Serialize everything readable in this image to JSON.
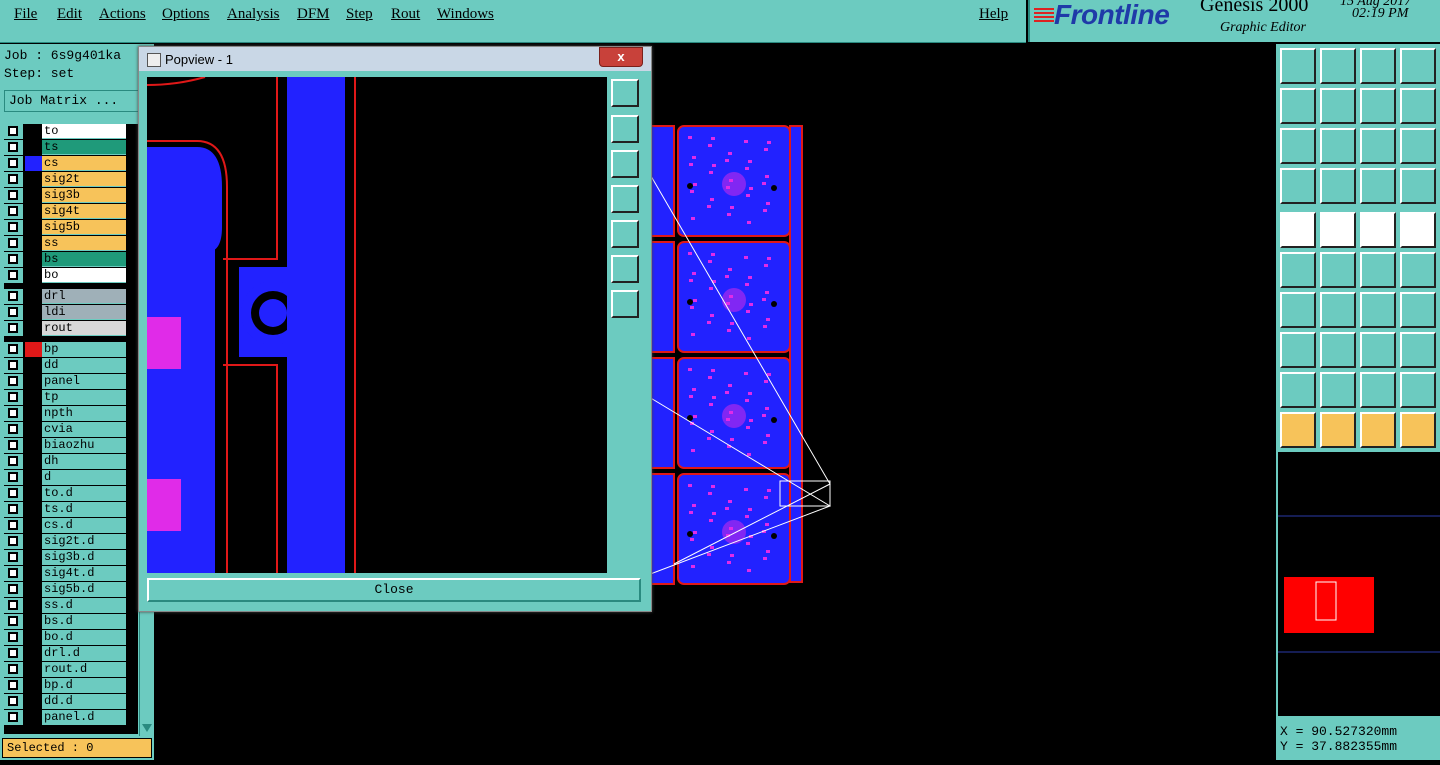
{
  "menu": {
    "items": [
      "File",
      "Edit",
      "Actions",
      "Options",
      "Analysis",
      "DFM",
      "Step",
      "Rout",
      "Windows"
    ],
    "help": "Help"
  },
  "brand": {
    "logo": "Frontline",
    "product": "Genesis 2000",
    "subtitle": "Graphic Editor",
    "date": "15 Aug 2017",
    "time": "02:19 PM"
  },
  "job": {
    "job_line": "Job : 6s9g401ka",
    "step_line": "Step: set",
    "matrix_button": "Job Matrix ..."
  },
  "layers": [
    {
      "name": "to",
      "bg": "#ffffff",
      "swatch": "#000000"
    },
    {
      "name": "ts",
      "bg": "#1f9a7a",
      "swatch": "#000000"
    },
    {
      "name": "cs",
      "bg": "#f7c35a",
      "swatch": "#2222ff"
    },
    {
      "name": "sig2t",
      "bg": "#f7c35a",
      "swatch": "#000000"
    },
    {
      "name": "sig3b",
      "bg": "#f7c35a",
      "swatch": "#000000"
    },
    {
      "name": "sig4t",
      "bg": "#f7c35a",
      "swatch": "#000000"
    },
    {
      "name": "sig5b",
      "bg": "#f7c35a",
      "swatch": "#000000"
    },
    {
      "name": "ss",
      "bg": "#f7c35a",
      "swatch": "#000000"
    },
    {
      "name": "bs",
      "bg": "#1f9a7a",
      "swatch": "#000000"
    },
    {
      "name": "bo",
      "bg": "#ffffff",
      "swatch": "#000000"
    },
    {
      "name": "drl",
      "bg": "#9fb0b8",
      "swatch": "#000000"
    },
    {
      "name": "ldi",
      "bg": "#9fb0b8",
      "swatch": "#000000"
    },
    {
      "name": "rout",
      "bg": "#d8d8d8",
      "swatch": "#000000"
    },
    {
      "name": "bp",
      "bg": "#6ccbc0",
      "swatch": "#e01818"
    },
    {
      "name": "dd",
      "bg": "#6ccbc0",
      "swatch": "#000000"
    },
    {
      "name": "panel",
      "bg": "#6ccbc0",
      "swatch": "#000000"
    },
    {
      "name": "tp",
      "bg": "#6ccbc0",
      "swatch": "#000000"
    },
    {
      "name": "npth",
      "bg": "#6ccbc0",
      "swatch": "#000000"
    },
    {
      "name": "cvia",
      "bg": "#6ccbc0",
      "swatch": "#000000"
    },
    {
      "name": "biaozhu",
      "bg": "#6ccbc0",
      "swatch": "#000000"
    },
    {
      "name": "dh",
      "bg": "#6ccbc0",
      "swatch": "#000000"
    },
    {
      "name": "d",
      "bg": "#6ccbc0",
      "swatch": "#000000"
    },
    {
      "name": "to.d",
      "bg": "#6ccbc0",
      "swatch": "#000000"
    },
    {
      "name": "ts.d",
      "bg": "#6ccbc0",
      "swatch": "#000000"
    },
    {
      "name": "cs.d",
      "bg": "#6ccbc0",
      "swatch": "#000000"
    },
    {
      "name": "sig2t.d",
      "bg": "#6ccbc0",
      "swatch": "#000000"
    },
    {
      "name": "sig3b.d",
      "bg": "#6ccbc0",
      "swatch": "#000000"
    },
    {
      "name": "sig4t.d",
      "bg": "#6ccbc0",
      "swatch": "#000000"
    },
    {
      "name": "sig5b.d",
      "bg": "#6ccbc0",
      "swatch": "#000000"
    },
    {
      "name": "ss.d",
      "bg": "#6ccbc0",
      "swatch": "#000000"
    },
    {
      "name": "bs.d",
      "bg": "#6ccbc0",
      "swatch": "#000000"
    },
    {
      "name": "bo.d",
      "bg": "#6ccbc0",
      "swatch": "#000000"
    },
    {
      "name": "drl.d",
      "bg": "#6ccbc0",
      "swatch": "#000000"
    },
    {
      "name": "rout.d",
      "bg": "#6ccbc0",
      "swatch": "#000000"
    },
    {
      "name": "bp.d",
      "bg": "#6ccbc0",
      "swatch": "#000000"
    },
    {
      "name": "dd.d",
      "bg": "#6ccbc0",
      "swatch": "#000000"
    },
    {
      "name": "panel.d",
      "bg": "#6ccbc0",
      "swatch": "#000000"
    }
  ],
  "selected": "Selected : 0",
  "popview": {
    "title": "Popview - 1",
    "close_x": "x",
    "close_button": "Close"
  },
  "coords": {
    "x": "X = 90.527320mm",
    "y": "Y = 37.882355mm"
  },
  "colors": {
    "teal": "#6ccbc0",
    "pcb_blue": "#2222ff",
    "pcb_magenta": "#e02be8",
    "outline_red": "#e01818"
  }
}
